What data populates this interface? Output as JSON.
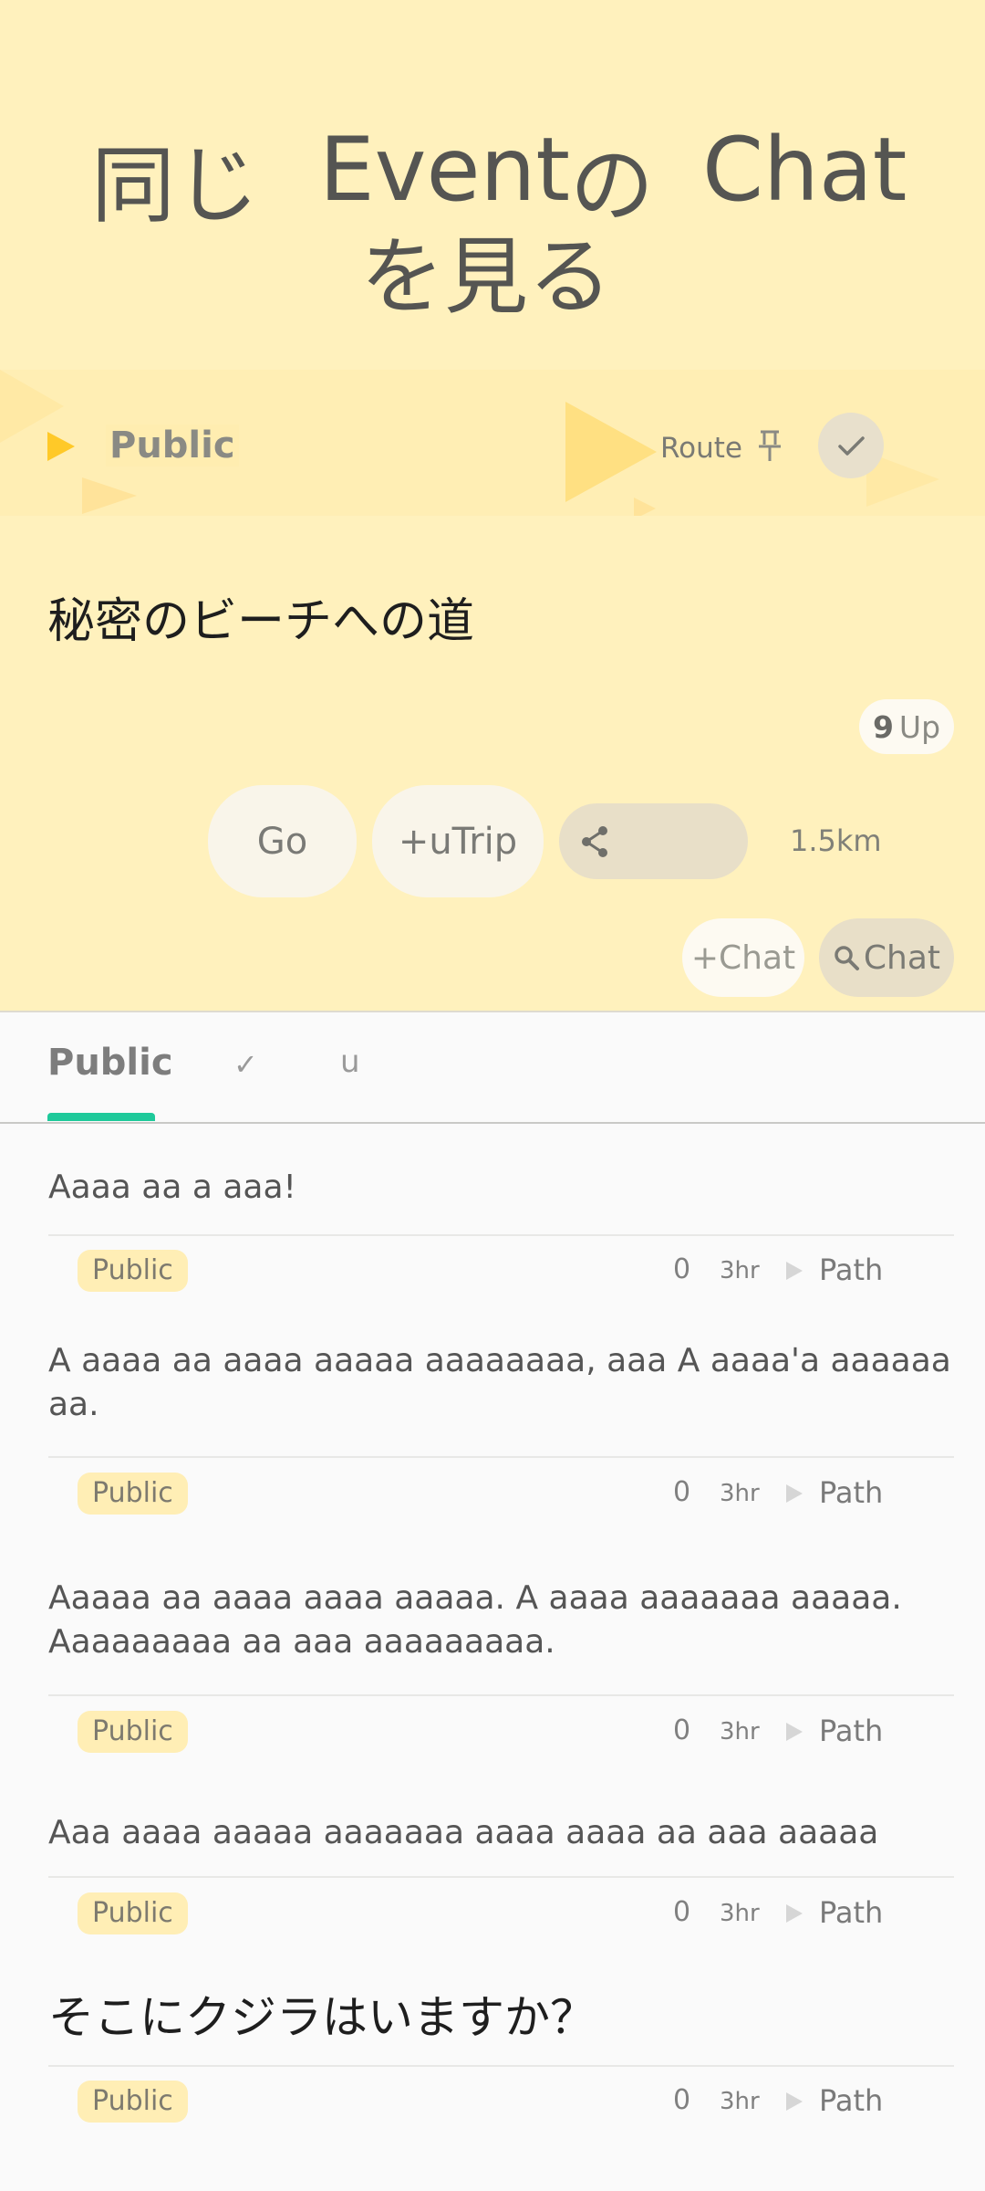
{
  "header": {
    "title_parts": [
      "同じ",
      "Event",
      "の",
      "Chat",
      "を見る"
    ]
  },
  "band": {
    "label": "Public",
    "route_label": "Route",
    "icons": [
      "play-icon",
      "pin-icon",
      "check-icon"
    ]
  },
  "event": {
    "title": "秘密のビーチへの道",
    "up_count": "9",
    "up_label": "Up",
    "go_label": "Go",
    "utrip_label": "+uTrip",
    "distance": "1.5km",
    "add_chat_label": "+Chat",
    "search_chat_label": "Chat"
  },
  "tabs": [
    {
      "label": "Public",
      "active": true
    },
    {
      "label": "✓",
      "active": false
    },
    {
      "label": "u",
      "active": false
    }
  ],
  "colors": {
    "header_bg": "#fff1bd",
    "accent": "#1ec99a",
    "badge_bg": "#ffeeb5"
  },
  "posts": [
    {
      "text": "Aaaa aa a aaa!",
      "badge": "Public",
      "count": "0",
      "age": "3hr",
      "path_label": "Path"
    },
    {
      "text": "A aaaa aa aaaa aaaaa aaaaaaaa, aaa A aaaa'a aaaaaa aa.",
      "badge": "Public",
      "count": "0",
      "age": "3hr",
      "path_label": "Path"
    },
    {
      "text": "Aaaaa aa aaaa aaaa aaaaa. A aaaa aaaaaaa aaaaa. Aaaaaaaaa aa aaa aaaaaaaaa.",
      "badge": "Public",
      "count": "0",
      "age": "3hr",
      "path_label": "Path"
    },
    {
      "text": "Aaa aaaa aaaaa aaaaaaa aaaa aaaa aa aaa aaaaa",
      "badge": "Public",
      "count": "0",
      "age": "3hr",
      "path_label": "Path"
    },
    {
      "text": "そこにクジラはいますか？",
      "badge": "Public",
      "count": "0",
      "age": "3hr",
      "path_label": "Path"
    }
  ]
}
